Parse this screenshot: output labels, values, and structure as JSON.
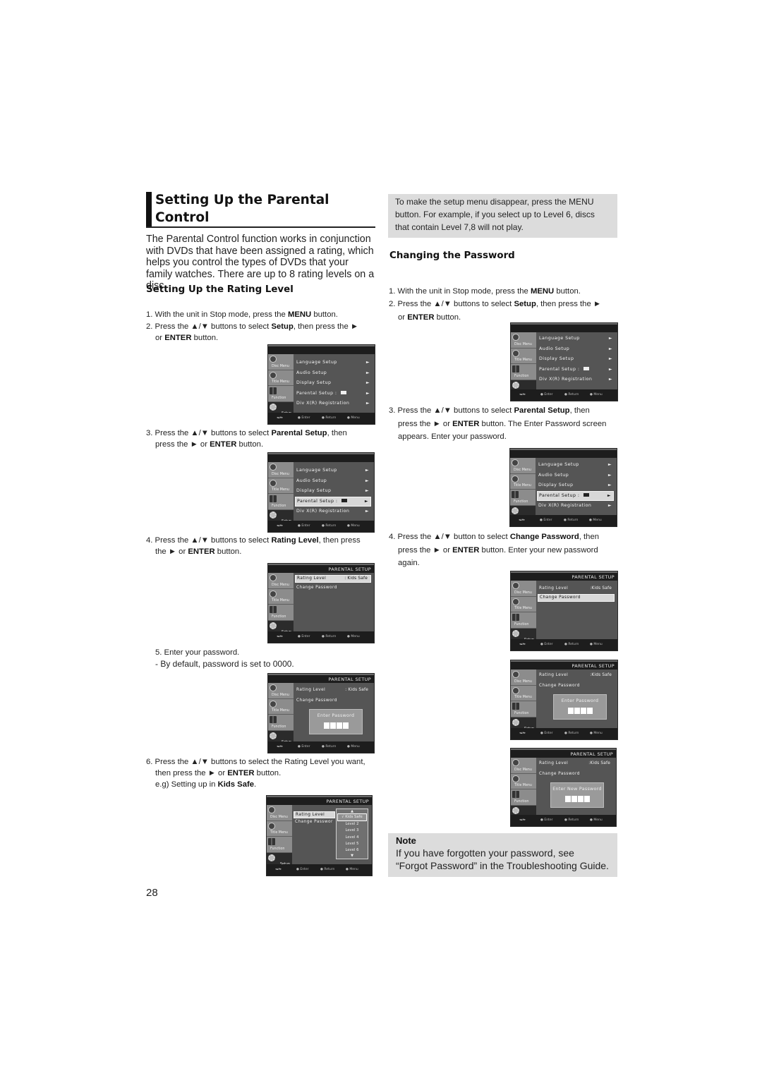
{
  "page": {
    "title": "Setting Up the Parental Control",
    "intro": "The Parental Control function works in conjunction with DVDs that have been assigned a rating, which helps you control the types of DVDs that your family watches. There are up to 8 rating levels on a disc.",
    "page_number": "28"
  },
  "left": {
    "heading": "Setting Up the Rating Level",
    "step1": {
      "pre": "1. With the unit in Stop mode, press the ",
      "b1": "MENU",
      "post": " button."
    },
    "step2": {
      "pre": "2. Press the ▲/▼ buttons to select ",
      "b1": "Setup",
      "mid": ", then press the ►",
      "l2pre": "or ",
      "b2": "ENTER",
      "post": " button."
    },
    "step3": {
      "pre": "3. Press the ▲/▼ buttons to select ",
      "b1": "Parental Setup",
      "mid": ", then",
      "l2pre": "press the ► or ",
      "b2": "ENTER",
      "post": " button."
    },
    "step4": {
      "pre": "4. Press the ▲/▼ buttons to select ",
      "b1": "Rating Level",
      "mid": ", then press",
      "l2pre": "the ► or ",
      "b2": "ENTER",
      "post": " button."
    },
    "step5": {
      "line1": "5. Enter your password.",
      "line2": "- By default, password is set to 0000."
    },
    "step6": {
      "pre": "6. Press the ▲/▼ buttons to select the Rating Level you want,",
      "l2pre": "then press the ► or ",
      "b2": "ENTER",
      "post": " button.",
      "l3pre": "e.g) Setting up in ",
      "b3": "Kids Safe",
      "l3post": "."
    }
  },
  "right": {
    "info_box": "To make the setup menu disappear, press the MENU button. For example, if you select up to Level 6, discs that contain Level 7,8 will not play.",
    "heading": "Changing the Password",
    "step1": {
      "pre": "1. With the unit in Stop mode, press the ",
      "b1": "MENU",
      "post": " button."
    },
    "step2": {
      "pre": "2. Press the ▲/▼ buttons to select ",
      "b1": "Setup",
      "mid": ", then press the ►",
      "l2pre": "or ",
      "b2": "ENTER",
      "post": " button."
    },
    "step3": {
      "pre": "3. Press the ▲/▼ buttons to select ",
      "b1": "Parental Setup",
      "mid": ", then",
      "l2pre": "press the ► or ",
      "b2": "ENTER",
      "l2post": " button. The Enter Password screen",
      "l3": "appears. Enter your password."
    },
    "step4": {
      "pre": "4. Press the ▲/▼ button to select ",
      "b1": "Change Password",
      "mid": ", then",
      "l2pre": "press the ► or ",
      "b2": "ENTER",
      "l2post": " button. Enter your new password",
      "l3": "again."
    },
    "note": {
      "title": "Note",
      "line1": "If you have forgotten your password, see",
      "line2": "“Forgot Password” in the Troubleshooting Guide."
    }
  },
  "osd": {
    "side_tabs": [
      "Disc Menu",
      "Title Menu",
      "Function",
      "Setup"
    ],
    "setup_items": [
      "Language Setup",
      "Audio Setup",
      "Display Setup",
      "Parental Setup :",
      "Div X(R) Registration"
    ],
    "arrow": "►",
    "footer": {
      "nav": "◂▴▾▸",
      "enter": "● Enter",
      "return": "● Return",
      "menu": "● Menu"
    },
    "parental_title": "PARENTAL SETUP",
    "rating_label": "Rating Level",
    "rating_value": ": Kids Safe",
    "rating_value_alt": ":Kids Safe",
    "change_password": "Change Password",
    "change_password_cut": "Change Passwor",
    "enter_password": "Enter Password",
    "enter_new_password": "Enter New Password",
    "levels": [
      "√ Kids Safe",
      "Level 2",
      "Level 3",
      "Level 4",
      "Level 5",
      "Level 6"
    ],
    "up": "▲",
    "down": "▼"
  }
}
